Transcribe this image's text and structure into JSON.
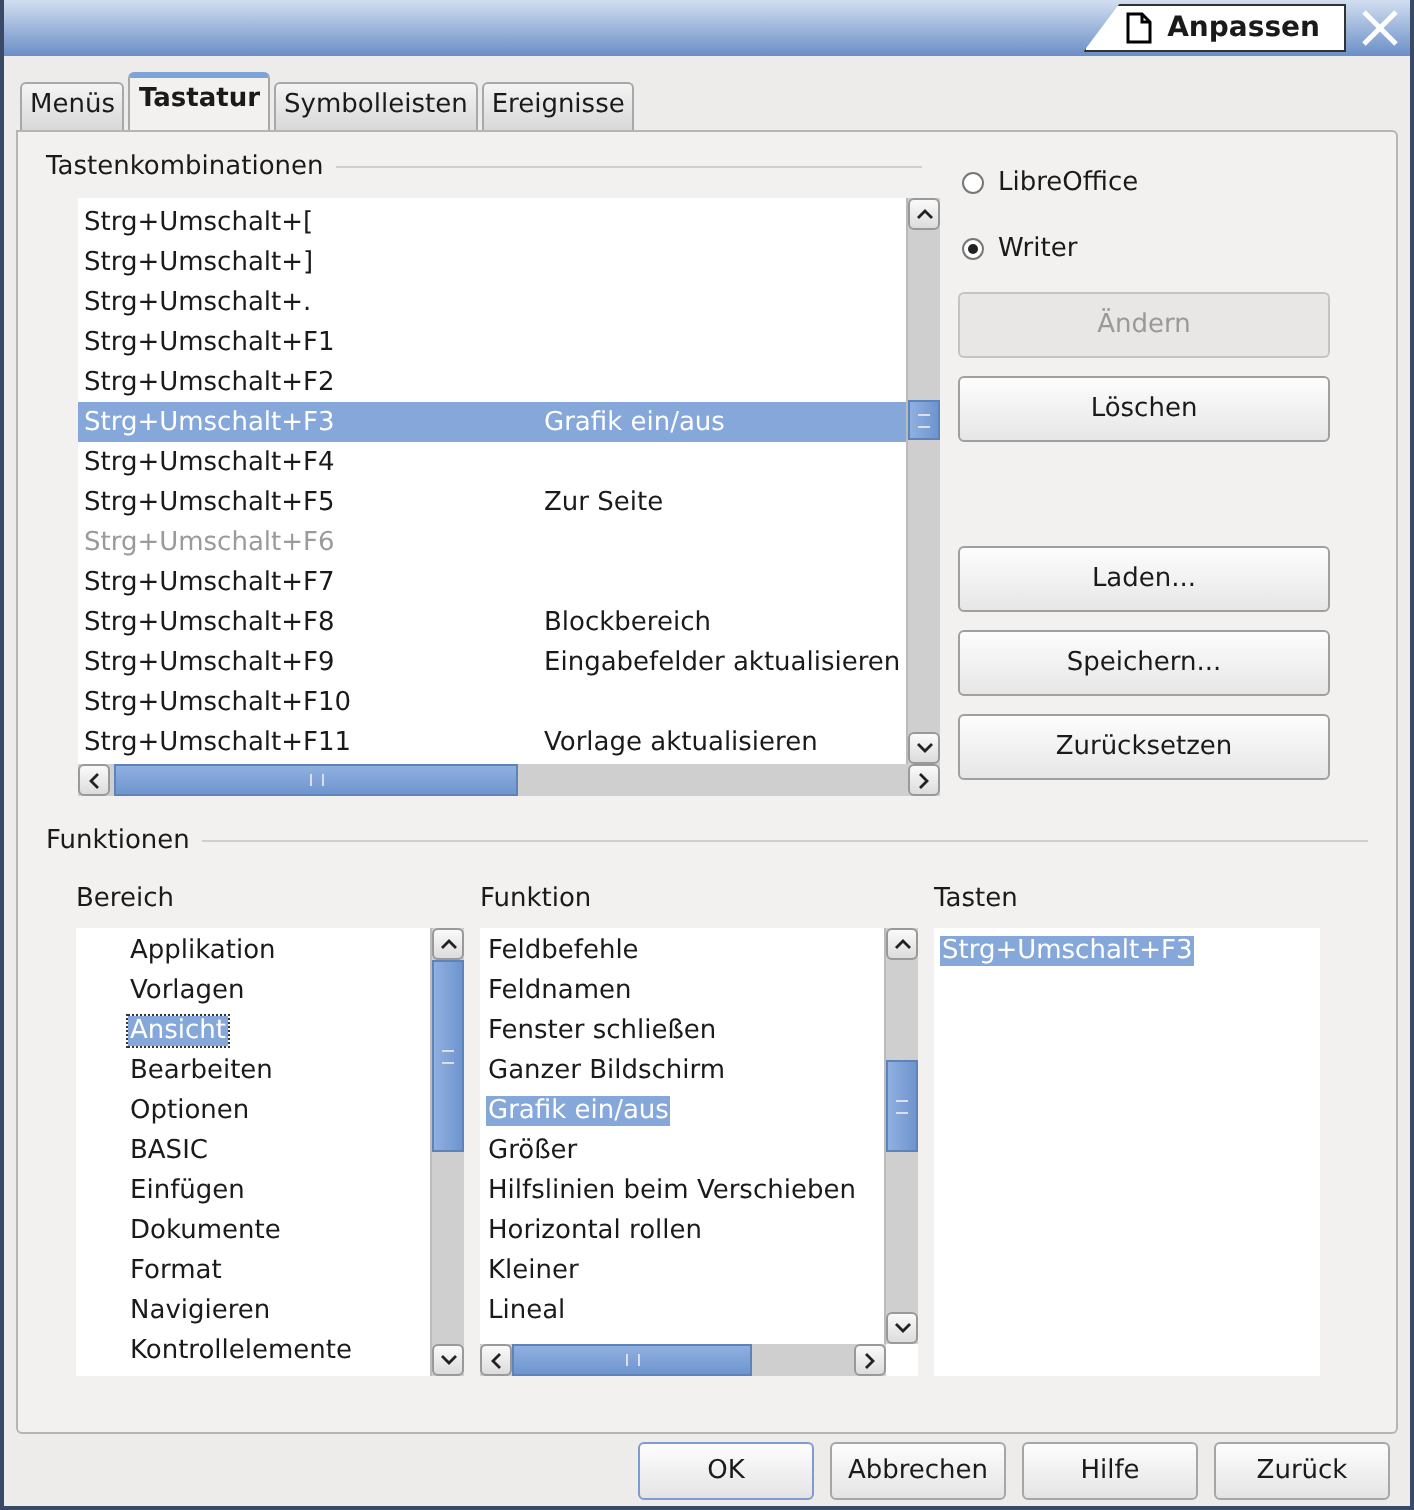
{
  "window": {
    "title": "Anpassen"
  },
  "tabs": [
    {
      "label": "Menüs",
      "selected": false
    },
    {
      "label": "Tastatur",
      "selected": true
    },
    {
      "label": "Symbolleisten",
      "selected": false
    },
    {
      "label": "Ereignisse",
      "selected": false
    }
  ],
  "shortcuts": {
    "title": "Tastenkombinationen",
    "rows": [
      {
        "key": "Strg+Umschalt+[",
        "function": "",
        "selected": false,
        "disabled": false
      },
      {
        "key": "Strg+Umschalt+]",
        "function": "",
        "selected": false,
        "disabled": false
      },
      {
        "key": "Strg+Umschalt+.",
        "function": "",
        "selected": false,
        "disabled": false
      },
      {
        "key": "Strg+Umschalt+F1",
        "function": "",
        "selected": false,
        "disabled": false
      },
      {
        "key": "Strg+Umschalt+F2",
        "function": "",
        "selected": false,
        "disabled": false
      },
      {
        "key": "Strg+Umschalt+F3",
        "function": "Grafik ein/aus",
        "selected": true,
        "disabled": false
      },
      {
        "key": "Strg+Umschalt+F4",
        "function": "",
        "selected": false,
        "disabled": false
      },
      {
        "key": "Strg+Umschalt+F5",
        "function": "Zur Seite",
        "selected": false,
        "disabled": false
      },
      {
        "key": "Strg+Umschalt+F6",
        "function": "",
        "selected": false,
        "disabled": true
      },
      {
        "key": "Strg+Umschalt+F7",
        "function": "",
        "selected": false,
        "disabled": false
      },
      {
        "key": "Strg+Umschalt+F8",
        "function": "Blockbereich",
        "selected": false,
        "disabled": false
      },
      {
        "key": "Strg+Umschalt+F9",
        "function": "Eingabefelder aktualisieren",
        "selected": false,
        "disabled": false
      },
      {
        "key": "Strg+Umschalt+F10",
        "function": "",
        "selected": false,
        "disabled": false
      },
      {
        "key": "Strg+Umschalt+F11",
        "function": "Vorlage aktualisieren",
        "selected": false,
        "disabled": false
      }
    ]
  },
  "scope": [
    {
      "label": "LibreOffice",
      "selected": false
    },
    {
      "label": "Writer",
      "selected": true
    }
  ],
  "actions": [
    {
      "label": "Ändern",
      "disabled": true
    },
    {
      "label": "Löschen",
      "disabled": false
    },
    {
      "label": "Laden...",
      "disabled": false
    },
    {
      "label": "Speichern...",
      "disabled": false
    },
    {
      "label": "Zurücksetzen",
      "disabled": false
    }
  ],
  "functions": {
    "title": "Funktionen",
    "category": {
      "label": "Bereich",
      "items": [
        {
          "label": "Applikation",
          "selected": false
        },
        {
          "label": "Vorlagen",
          "selected": false
        },
        {
          "label": "Ansicht",
          "selected": true
        },
        {
          "label": "Bearbeiten",
          "selected": false
        },
        {
          "label": "Optionen",
          "selected": false
        },
        {
          "label": "BASIC",
          "selected": false
        },
        {
          "label": "Einfügen",
          "selected": false
        },
        {
          "label": "Dokumente",
          "selected": false
        },
        {
          "label": "Format",
          "selected": false
        },
        {
          "label": "Navigieren",
          "selected": false
        },
        {
          "label": "Kontrollelemente",
          "selected": false
        }
      ]
    },
    "function": {
      "label": "Funktion",
      "items": [
        {
          "label": "Feldbefehle",
          "selected": false
        },
        {
          "label": "Feldnamen",
          "selected": false
        },
        {
          "label": "Fenster schließen",
          "selected": false
        },
        {
          "label": "Ganzer Bildschirm",
          "selected": false
        },
        {
          "label": "Grafik ein/aus",
          "selected": true
        },
        {
          "label": "Größer",
          "selected": false
        },
        {
          "label": "Hilfslinien beim Verschieben",
          "selected": false
        },
        {
          "label": "Horizontal rollen",
          "selected": false
        },
        {
          "label": "Kleiner",
          "selected": false
        },
        {
          "label": "Lineal",
          "selected": false
        }
      ]
    },
    "keys": {
      "label": "Tasten",
      "items": [
        {
          "label": "Strg+Umschalt+F3",
          "selected": true
        }
      ]
    }
  },
  "buttons": [
    {
      "label": "OK",
      "default": true
    },
    {
      "label": "Abbrechen",
      "default": false
    },
    {
      "label": "Hilfe",
      "default": false
    },
    {
      "label": "Zurück",
      "default": false
    }
  ]
}
